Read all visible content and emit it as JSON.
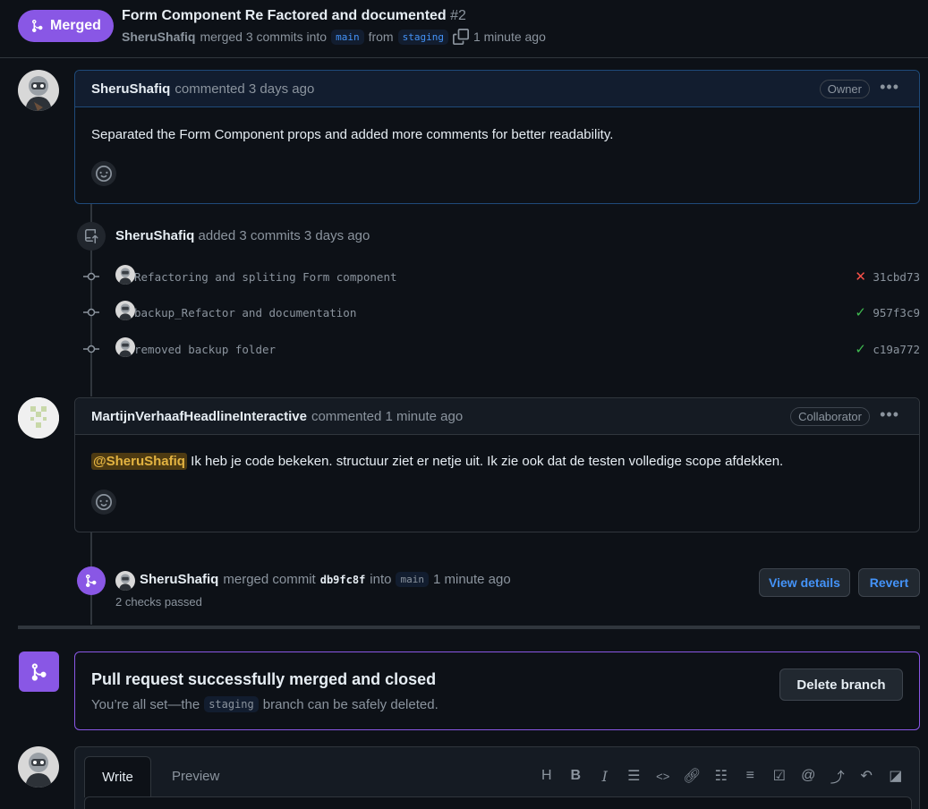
{
  "header": {
    "status": "Merged",
    "title": "Form Component Re Factored and documented",
    "number": "#2",
    "author": "SheruShafiq",
    "merged_text": "merged 3 commits into",
    "base_branch": "main",
    "from_text": "from",
    "head_branch": "staging",
    "time": "1 minute ago"
  },
  "comments": [
    {
      "author": "SheruShafiq",
      "meta": "commented 3 days ago",
      "role": "Owner",
      "body": "Separated the Form Component props and added more comments for better readability."
    },
    {
      "author": "MartijnVerhaafHeadlineInteractive",
      "meta": "commented 1 minute ago",
      "role": "Collaborator",
      "mention": "@SheruShafiq",
      "body": " Ik heb je code bekeken. structuur ziet er netje uit. Ik zie ook dat de testen volledige scope afdekken."
    }
  ],
  "commits_event": {
    "author": "SheruShafiq",
    "text": "added 3 commits 3 days ago",
    "commits": [
      {
        "message": "Refactoring and spliting Form component",
        "status": "fail",
        "status_glyph": "✕",
        "sha": "31cbd73"
      },
      {
        "message": "backup_Refactor and documentation",
        "status": "pass",
        "status_glyph": "✓",
        "sha": "957f3c9"
      },
      {
        "message": "removed backup folder",
        "status": "pass",
        "status_glyph": "✓",
        "sha": "c19a772"
      }
    ]
  },
  "merge_event": {
    "author": "SheruShafiq",
    "text": "merged commit",
    "sha": "db9fc8f",
    "into": "into",
    "branch": "main",
    "time": "1 minute ago",
    "checks": "2 checks passed",
    "view_details": "View details",
    "revert": "Revert"
  },
  "merged_box": {
    "title": "Pull request successfully merged and closed",
    "text_before": "You’re all set—the",
    "branch": "staging",
    "text_after": "branch can be safely deleted.",
    "delete_button": "Delete branch"
  },
  "editor": {
    "tab_write": "Write",
    "tab_preview": "Preview"
  },
  "colors": {
    "merged": "#8957e5",
    "link": "#4493f8",
    "fail": "#f85149",
    "pass": "#3fb950",
    "background": "#0d1117"
  }
}
